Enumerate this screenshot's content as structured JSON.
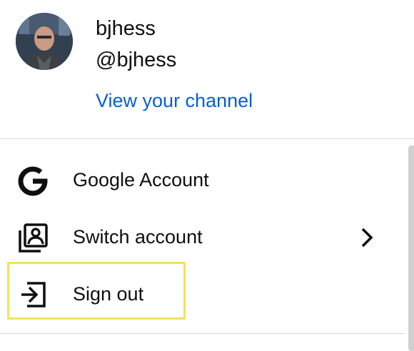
{
  "account": {
    "name": "bjhess",
    "handle": "@bjhess",
    "channel_link": "View your channel",
    "avatar_icon": "user-avatar-photo"
  },
  "menu": {
    "items": [
      {
        "label": "Google Account",
        "icon": "google-g-icon"
      },
      {
        "label": "Switch account",
        "icon": "switch-account-icon",
        "trailing_icon": "chevron-right-icon"
      },
      {
        "label": "Sign out",
        "icon": "sign-out-icon",
        "highlighted": true
      }
    ]
  },
  "colors": {
    "link": "#065fd4",
    "text": "#0f0f0f",
    "divider": "#d9d9d9",
    "highlight": "#f0e35a"
  }
}
